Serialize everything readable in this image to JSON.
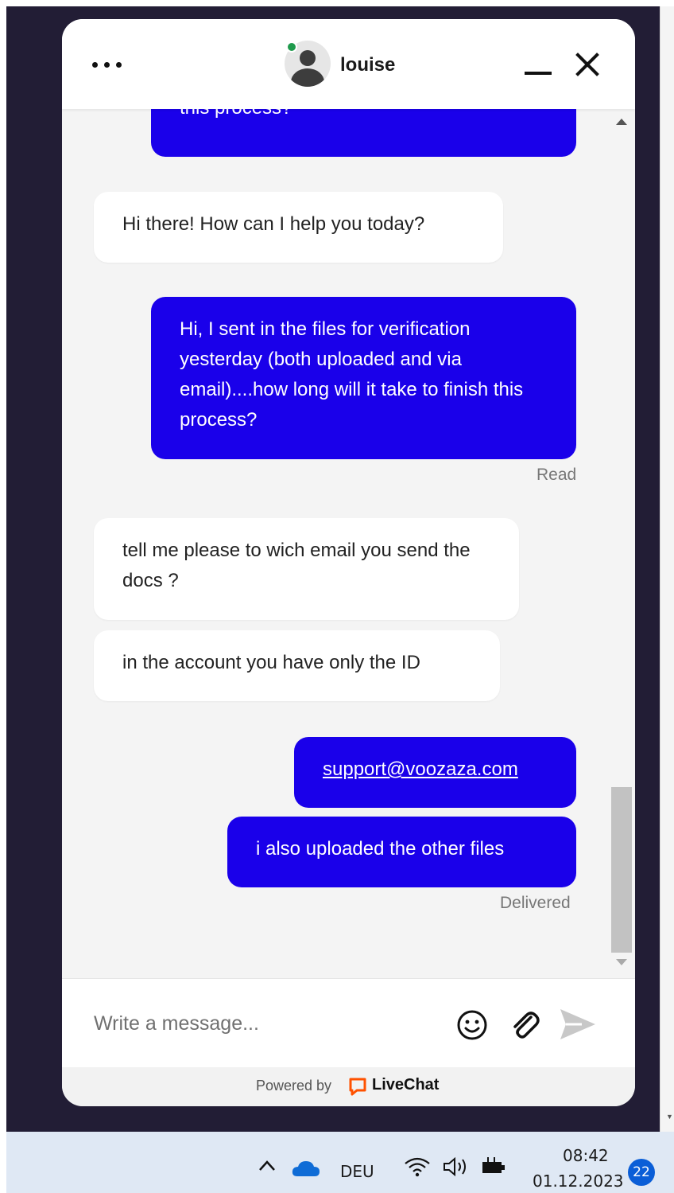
{
  "chat": {
    "agent_name": "louise",
    "input_placeholder": "Write a message...",
    "footer_powered_by": "Powered by",
    "footer_brand": "LiveChat"
  },
  "messages": [
    {
      "author": "visitor",
      "text": "this process?"
    },
    {
      "author": "agent",
      "text": "Hi there! How can I help you today?"
    },
    {
      "author": "visitor",
      "text": "Hi, I sent in the files for verification yesterday (both uploaded and via email)....how long will it take to finish this process?"
    },
    {
      "author": "status",
      "text": "Read"
    },
    {
      "author": "agent",
      "text": "tell me please to wich email you send the docs ?"
    },
    {
      "author": "agent",
      "text": "in the account you have only the ID"
    },
    {
      "author": "visitor",
      "text": "support@voozaza.com"
    },
    {
      "author": "visitor",
      "text": "i also uploaded the other files"
    },
    {
      "author": "status",
      "text": "Delivered"
    }
  ],
  "taskbar": {
    "language": "DEU",
    "time": "08:42",
    "date": "01.12.2023",
    "notification_count": "22"
  },
  "colors": {
    "visitor_bubble": "#1a00ea",
    "agent_bubble": "#ffffff",
    "online_status": "#1f9a4c",
    "livechat_brand": "#ff5100",
    "desktop_background": "#221d35"
  }
}
